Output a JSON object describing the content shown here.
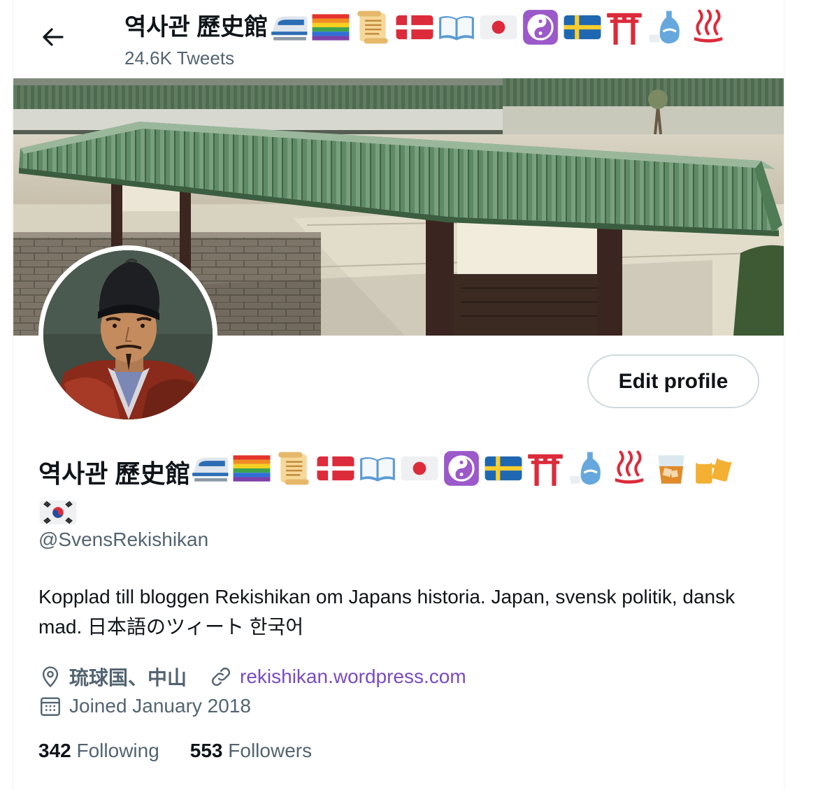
{
  "header": {
    "title": "역사관 歷史館",
    "tweet_count": "24.6K Tweets"
  },
  "profile": {
    "display_name": "역사관 歷史館",
    "handle": "@SvensRekishikan",
    "bio": "Kopplad till bloggen Rekishikan om Japans historia. Japan, svensk politik, dansk mad. 日本語のツィート 한국어",
    "location": "琉球国、中山",
    "website": "rekishikan.wordpress.com",
    "joined": "Joined January 2018",
    "following_count": "342",
    "following_label": "Following",
    "followers_count": "553",
    "followers_label": "Followers",
    "edit_label": "Edit profile",
    "name_emojis": [
      "bullet-train",
      "rainbow-flag",
      "scroll",
      "flag-denmark",
      "open-book",
      "flag-japan",
      "yin-yang",
      "flag-sweden",
      "torii-gate",
      "sake",
      "hot-springs",
      "tumbler-glass",
      "beer-mugs",
      "flag-south-korea"
    ],
    "header_emojis": [
      "bullet-train",
      "rainbow-flag",
      "scroll",
      "flag-denmark",
      "open-book",
      "flag-japan",
      "yin-yang",
      "flag-sweden",
      "torii-gate",
      "sake",
      "hot-springs"
    ]
  },
  "colors": {
    "link": "#794bc4",
    "secondary_text": "#536471",
    "primary_text": "#0f1419",
    "border": "#cfd9de"
  }
}
